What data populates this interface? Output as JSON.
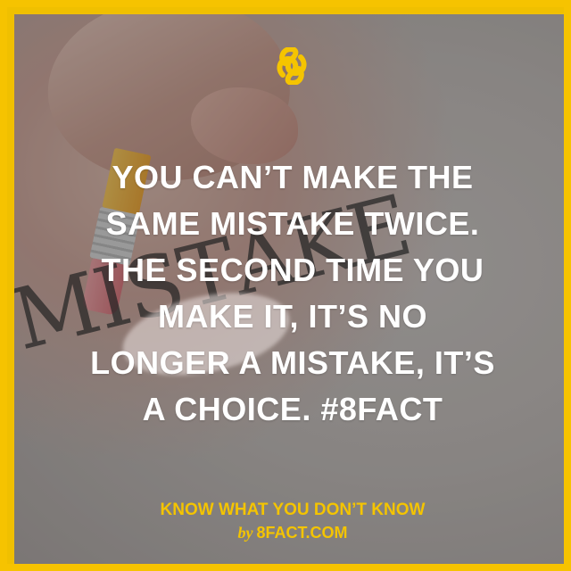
{
  "brand": {
    "icon": "infinity-8-logo",
    "accent_color": "#f5c400"
  },
  "background": {
    "word": [
      "M",
      "I",
      "S",
      "T",
      "A",
      "K",
      "E"
    ]
  },
  "quote": {
    "lines": [
      "YOU CAN’T MAKE THE",
      "SAME MISTAKE TWICE.",
      "THE SECOND TIME YOU",
      "MAKE IT, IT’S NO",
      "LONGER A MISTAKE, IT’S",
      "A CHOICE. #8FACT"
    ]
  },
  "footer": {
    "tagline": "KNOW WHAT YOU DON’T KNOW",
    "by": "by",
    "site": "8FACT.COM"
  }
}
